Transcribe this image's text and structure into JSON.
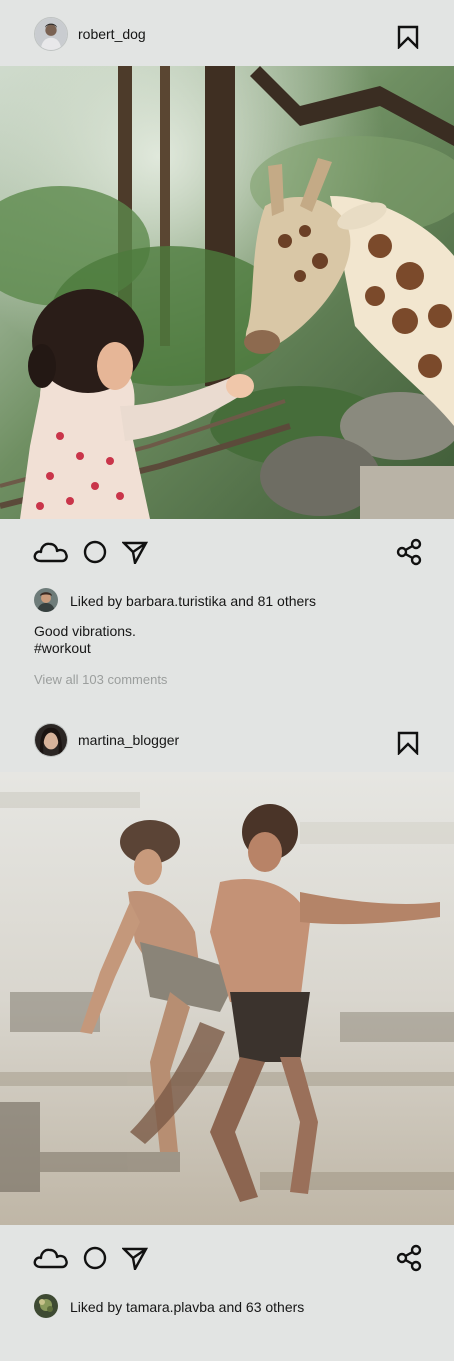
{
  "colors": {
    "background": "#e2e4e3",
    "text": "#161616",
    "muted": "#9b9e9d"
  },
  "posts": [
    {
      "username": "robert_dog",
      "avatar_icon": "user-avatar",
      "bookmark_icon": "bookmark-icon",
      "image_description_icon": "photo-child-feeding-giraffe",
      "actions": {
        "like_icon": "cloud-icon",
        "comment_icon": "circle-icon",
        "send_icon": "send-icon",
        "share_icon": "share-icon"
      },
      "liked_by_prefix": "Liked by ",
      "liked_by_user": "barbara.turistika",
      "liked_by_suffix": " and 81 others",
      "caption": "Good vibrations.",
      "hashtag": "#workout",
      "view_comments": "View all 103 comments"
    },
    {
      "username": "martina_blogger",
      "avatar_icon": "user-avatar",
      "bookmark_icon": "bookmark-icon",
      "image_description_icon": "painting-dancing-couple",
      "actions": {
        "like_icon": "cloud-icon",
        "comment_icon": "circle-icon",
        "send_icon": "send-icon",
        "share_icon": "share-icon"
      },
      "liked_by_prefix": "Liked by ",
      "liked_by_user": "tamara.plavba",
      "liked_by_suffix": " and 63 others"
    }
  ]
}
